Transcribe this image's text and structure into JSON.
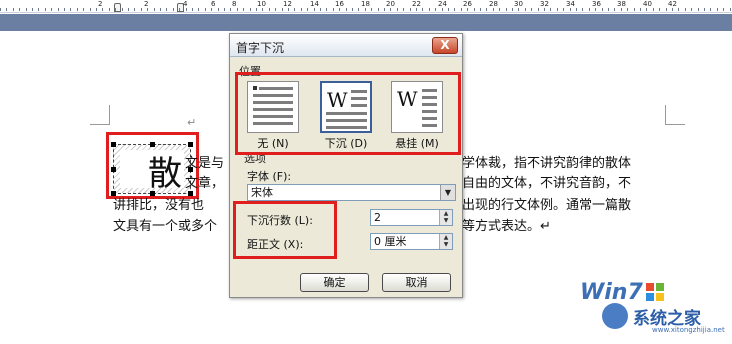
{
  "ruler": {
    "numbers": [
      "2",
      "2",
      "4",
      "6",
      "8",
      "10",
      "12",
      "14",
      "16",
      "18",
      "20",
      "22",
      "24",
      "26",
      "28",
      "30",
      "32",
      "34",
      "36",
      "38",
      "40",
      "42"
    ]
  },
  "document": {
    "lines": [
      "文是与",
      "文章，",
      "讲排比，没有也",
      "文具有一个或多个"
    ],
    "right_lines": [
      "学体裁，指不讲究韵律的散体",
      "自由的文体，不讲究音韵，不",
      "出现的行文体例。通常一篇散",
      "等方式表达。↵"
    ],
    "para_mark": "↵",
    "drop_cap_char": "散"
  },
  "dialog": {
    "title": "首字下沉",
    "close_label": "X",
    "position_label": "位置",
    "options": [
      {
        "label": "无 (N)",
        "letter": ""
      },
      {
        "label": "下沉 (D)",
        "letter": "W"
      },
      {
        "label": "悬挂 (M)",
        "letter": "W"
      }
    ],
    "options_label": "选项",
    "font_label": "字体 (F):",
    "font_value": "宋体",
    "lines_label": "下沉行数 (L):",
    "lines_value": "2",
    "distance_label": "距正文 (X):",
    "distance_value": "0 厘米",
    "ok_label": "确定",
    "cancel_label": "取消"
  },
  "watermark": {
    "logo": "Win7",
    "site_name": "系统之家",
    "url": "www.xitongzhijia.net"
  },
  "colors": {
    "highlight_red": "#e01e1e",
    "ruler_band": "#6a7fa1",
    "dialog_bg": "#ece9d8"
  }
}
